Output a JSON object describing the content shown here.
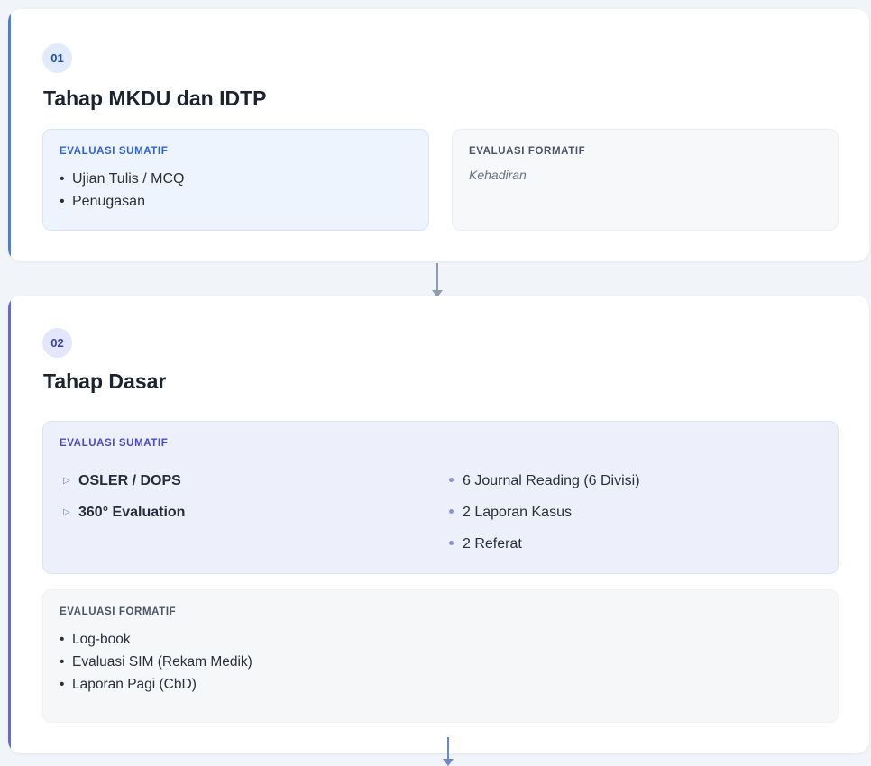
{
  "stages": [
    {
      "number": "01",
      "title": "Tahap MKDU dan IDTP",
      "summative": {
        "heading": "EVALUASI SUMATIF",
        "items": [
          "Ujian Tulis / MCQ",
          "Penugasan"
        ]
      },
      "formative": {
        "heading": "EVALUASI FORMATIF",
        "note": "Kehadiran"
      }
    },
    {
      "number": "02",
      "title": "Tahap Dasar",
      "summative": {
        "heading": "EVALUASI SUMATIF",
        "primary_items": [
          "OSLER / DOPS",
          "360° Evaluation"
        ],
        "secondary_items": [
          "6 Journal Reading (6 Divisi)",
          "2 Laporan Kasus",
          "2 Referat"
        ]
      },
      "formative": {
        "heading": "EVALUASI FORMATIF",
        "items": [
          "Log-book",
          "Evaluasi SIM (Rekam Medik)",
          "Laporan Pagi (CbD)"
        ]
      }
    }
  ],
  "bullet_glyph": "•",
  "triangle_glyph": "▷",
  "colors": {
    "stage1_accent": "#3b82f6",
    "stage2_accent": "#6366f1",
    "background": "#f1f4f8",
    "summative_panel_1": "#eef4fd",
    "summative_panel_2": "#edf0fb",
    "formative_panel": "#f6f8fa"
  },
  "icons": {
    "connector": "arrow-down-icon",
    "primary_bullet": "triangle-right-icon",
    "secondary_bullet": "dot-icon"
  }
}
